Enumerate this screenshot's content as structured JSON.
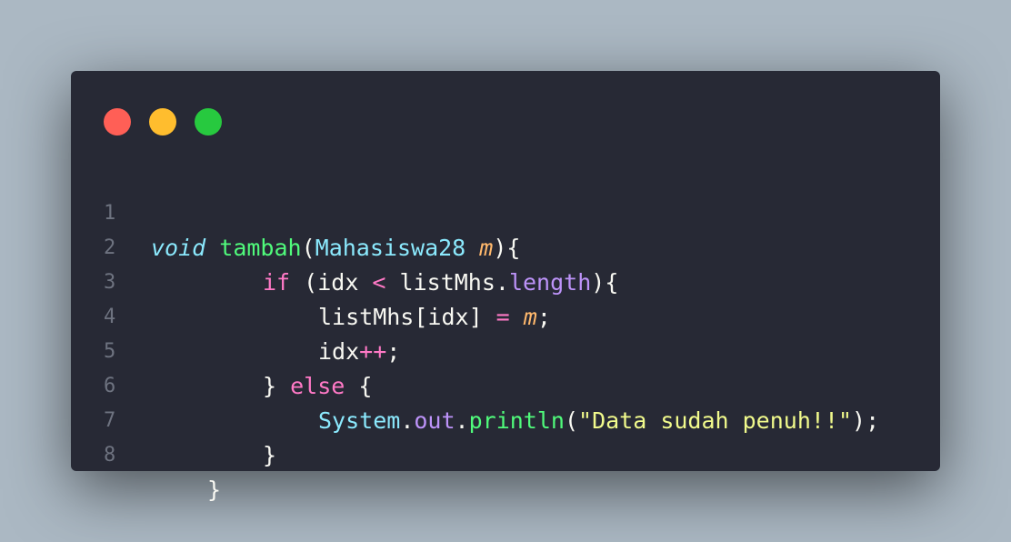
{
  "window": {
    "controls": [
      {
        "name": "close",
        "color": "#ff5f56"
      },
      {
        "name": "minimize",
        "color": "#ffbd2e"
      },
      {
        "name": "maximize",
        "color": "#27c93f"
      }
    ]
  },
  "code": {
    "lines": [
      {
        "number": "1",
        "tokens": [
          {
            "text": "void",
            "kind": "type"
          },
          {
            "text": " ",
            "kind": "plain"
          },
          {
            "text": "tambah",
            "kind": "fn"
          },
          {
            "text": "(",
            "kind": "plain"
          },
          {
            "text": "Mahasiswa28",
            "kind": "cls"
          },
          {
            "text": " ",
            "kind": "plain"
          },
          {
            "text": "m",
            "kind": "param"
          },
          {
            "text": "){",
            "kind": "plain"
          }
        ]
      },
      {
        "number": "2",
        "tokens": [
          {
            "text": "if",
            "kind": "kw"
          },
          {
            "text": " (idx ",
            "kind": "plain"
          },
          {
            "text": "<",
            "kind": "kw"
          },
          {
            "text": " listMhs.",
            "kind": "plain"
          },
          {
            "text": "length",
            "kind": "prop"
          },
          {
            "text": "){",
            "kind": "plain"
          }
        ]
      },
      {
        "number": "3",
        "tokens": [
          {
            "text": "listMhs[idx] ",
            "kind": "plain"
          },
          {
            "text": "=",
            "kind": "kw"
          },
          {
            "text": " ",
            "kind": "plain"
          },
          {
            "text": "m",
            "kind": "param"
          },
          {
            "text": ";",
            "kind": "plain"
          }
        ]
      },
      {
        "number": "4",
        "tokens": [
          {
            "text": "idx",
            "kind": "plain"
          },
          {
            "text": "++",
            "kind": "kw"
          },
          {
            "text": ";",
            "kind": "plain"
          }
        ]
      },
      {
        "number": "5",
        "tokens": [
          {
            "text": "} ",
            "kind": "plain"
          },
          {
            "text": "else",
            "kind": "kw"
          },
          {
            "text": " {",
            "kind": "plain"
          }
        ]
      },
      {
        "number": "6",
        "tokens": [
          {
            "text": "System",
            "kind": "cls"
          },
          {
            "text": ".",
            "kind": "plain"
          },
          {
            "text": "out",
            "kind": "prop"
          },
          {
            "text": ".",
            "kind": "plain"
          },
          {
            "text": "println",
            "kind": "fn"
          },
          {
            "text": "(",
            "kind": "plain"
          },
          {
            "text": "\"Data sudah penuh!!\"",
            "kind": "str"
          },
          {
            "text": ");",
            "kind": "plain"
          }
        ]
      },
      {
        "number": "7",
        "tokens": [
          {
            "text": "}",
            "kind": "plain"
          }
        ]
      },
      {
        "number": "8",
        "tokens": [
          {
            "text": "}",
            "kind": "plain"
          }
        ]
      }
    ]
  }
}
